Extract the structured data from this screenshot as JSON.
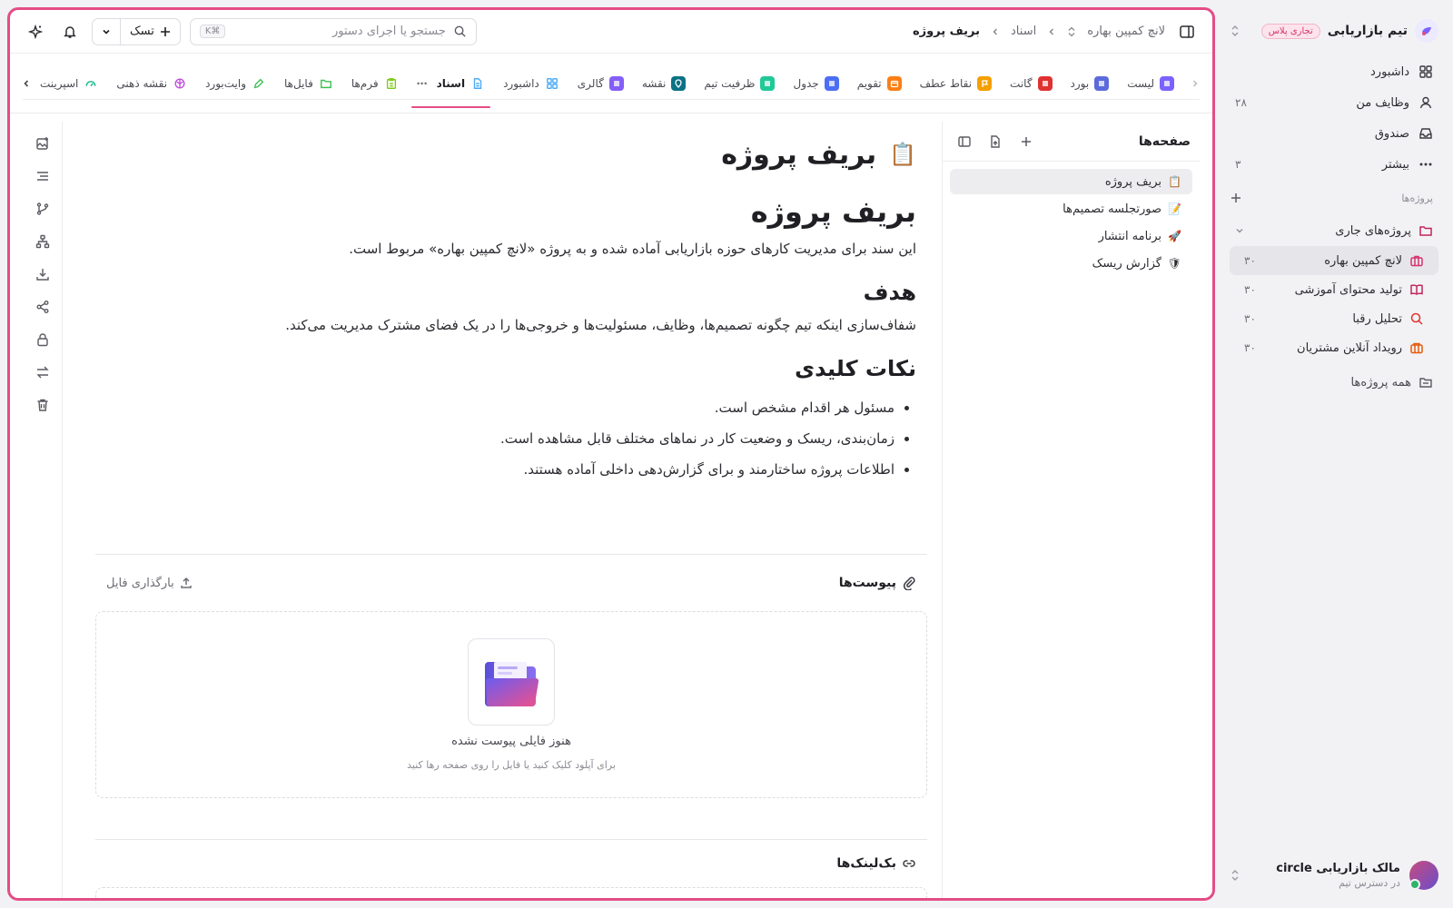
{
  "sidebar": {
    "workspace_name": "تیم بازاریابی",
    "plan_badge": "تجاری پلاس",
    "nav": [
      {
        "label": "داشبورد",
        "count": ""
      },
      {
        "label": "وظایف من",
        "count": "۲۸"
      },
      {
        "label": "صندوق",
        "count": ""
      },
      {
        "label": "بیشتر",
        "count": "۳"
      }
    ],
    "projects_label": "پروژه‌ها",
    "folder_label": "پروژه‌های جاری",
    "projects": [
      {
        "label": "لانچ کمپین بهاره",
        "count": "۳۰",
        "color": "#d6336c"
      },
      {
        "label": "تولید محتوای آموزشی",
        "count": "۳۰",
        "color": "#c2255c"
      },
      {
        "label": "تحلیل رقبا",
        "count": "۳۰",
        "color": "#e03131"
      },
      {
        "label": "رویداد آنلاین مشتریان",
        "count": "۳۰",
        "color": "#e8590c"
      }
    ],
    "all_projects": "همه پروژه‌ها",
    "user": {
      "name": "مالک بازاریابی circle",
      "sub": "در دسترس تیم"
    }
  },
  "topbar": {
    "breadcrumb": [
      "لانچ کمپین بهاره",
      "اسناد",
      "بریف پروژه"
    ],
    "search_placeholder": "جستجو یا اجرای دستور",
    "search_shortcut": "⌘K",
    "task_label": "تسک"
  },
  "views": [
    {
      "label": "لیست",
      "color": "#7b61ff"
    },
    {
      "label": "بورد",
      "color": "#5c6bdb"
    },
    {
      "label": "گانت",
      "color": "#e03131"
    },
    {
      "label": "نقاط عطف",
      "color": "#f59f00"
    },
    {
      "label": "تقویم",
      "color": "#fd7e14"
    },
    {
      "label": "جدول",
      "color": "#4c6ef5"
    },
    {
      "label": "ظرفیت تیم",
      "color": "#20c997"
    },
    {
      "label": "نقشه",
      "color": "#0b7285"
    },
    {
      "label": "گالری",
      "color": "#845ef7"
    },
    {
      "label": "داشبورد",
      "color": "#4dabf7"
    },
    {
      "label": "اسناد",
      "color": "#4dabf7"
    },
    {
      "label": "فرم‌ها",
      "color": "#82c91e"
    },
    {
      "label": "فایل‌ها",
      "color": "#40c057"
    },
    {
      "label": "وایت‌بورد",
      "color": "#40c057"
    },
    {
      "label": "نقشه ذهنی",
      "color": "#be4bdb"
    },
    {
      "label": "اسپرینت",
      "color": "#12b886"
    }
  ],
  "pages": {
    "title": "صفحه‌ها",
    "items": [
      {
        "emoji": "📋",
        "label": "بریف پروژه"
      },
      {
        "emoji": "📝",
        "label": "صورتجلسه تصمیم‌ها"
      },
      {
        "emoji": "🚀",
        "label": "برنامه انتشار"
      },
      {
        "emoji": "🛡",
        "label": "گزارش ریسک"
      }
    ]
  },
  "doc": {
    "emoji": "📋",
    "title": "بریف پروژه",
    "h1": "بریف پروژه",
    "intro": "این سند برای مدیریت کارهای حوزه بازاریابی آماده شده و به پروژه «لانچ کمپین بهاره» مربوط است.",
    "goal_heading": "هدف",
    "goal_text": "شفاف‌سازی اینکه تیم چگونه تصمیم‌ها، وظایف، مسئولیت‌ها و خروجی‌ها را در یک فضای مشترک مدیریت می‌کند.",
    "points_heading": "نکات کلیدی",
    "points": [
      "مسئول هر اقدام مشخص است.",
      "زمان‌بندی، ریسک و وضعیت کار در نماهای مختلف قابل مشاهده است.",
      "اطلاعات پروژه ساختارمند و برای گزارش‌دهی داخلی آماده هستند."
    ]
  },
  "attachments": {
    "title": "پیوست‌ها",
    "upload_label": "بارگذاری فایل",
    "empty_title": "هنوز فایلی پیوست نشده",
    "empty_sub": "برای آپلود کلیک کنید یا فایل را روی صفحه رها کنید"
  },
  "backlinks": {
    "title": "بک‌لینک‌ها"
  },
  "colors": {
    "accent": "#e34d86"
  }
}
